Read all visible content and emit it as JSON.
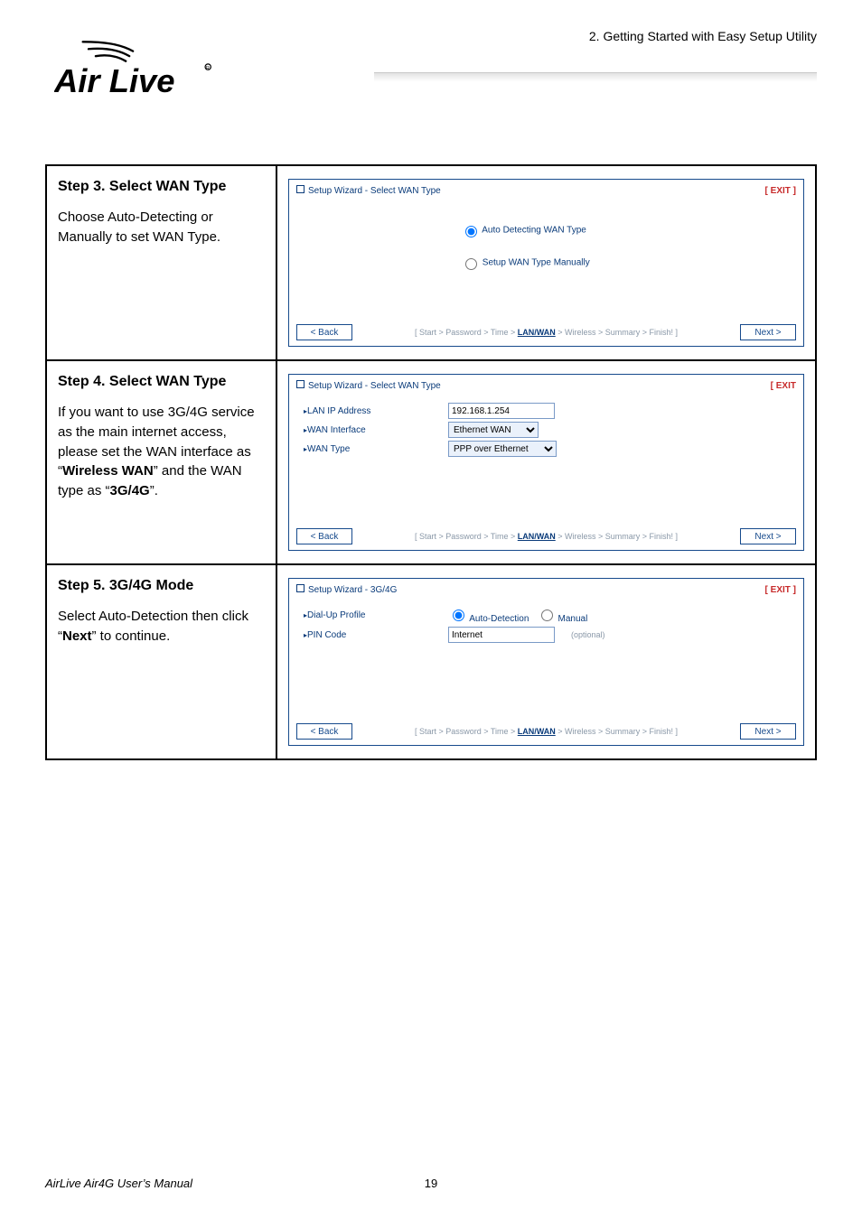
{
  "header": {
    "chapter": "2.  Getting  Started  with  Easy  Setup  Utility",
    "logo_alt": "Air Live"
  },
  "steps": {
    "s3": {
      "title": "Step 3.  Select WAN Type",
      "body": "Choose Auto-Detecting or Manually to set WAN Type."
    },
    "s4": {
      "title": "Step 4.  Select WAN Type",
      "body_1": "If you want to use 3G/4G service as the main internet access, please set the WAN interface as “",
      "body_bold1": "Wireless WAN",
      "body_2": "” and the WAN type as “",
      "body_bold2": "3G/4G",
      "body_3": "”."
    },
    "s5": {
      "title": "Step 5.  3G/4G Mode",
      "body_1": "Select Auto-Detection then click “",
      "body_bold": "Next",
      "body_2": "” to continue."
    }
  },
  "panel3": {
    "title": "Setup Wizard - Select WAN Type",
    "exit": "[ EXIT ]",
    "opt_auto": "Auto Detecting WAN Type",
    "opt_manual": "Setup WAN Type Manually",
    "back": "< Back",
    "next": "Next >",
    "crumb_prefix": "[ Start > Password > Time > ",
    "crumb_active": "LAN/WAN",
    "crumb_suffix": " > Wireless > Summary > Finish! ]"
  },
  "panel4": {
    "title": "Setup Wizard - Select WAN Type",
    "exit": "[ EXIT",
    "lan_label": "LAN IP Address",
    "lan_value": "192.168.1.254",
    "waninterface_label": "WAN Interface",
    "waninterface_value": "Ethernet WAN",
    "wantype_label": "WAN Type",
    "wantype_value": "PPP over Ethernet",
    "back": "< Back",
    "next": "Next >",
    "crumb_prefix": "[ Start > Password > Time > ",
    "crumb_active": "LAN/WAN",
    "crumb_suffix": " > Wireless > Summary > Finish! ]"
  },
  "panel5": {
    "title": "Setup Wizard - 3G/4G",
    "exit": "[ EXIT ]",
    "dialup_label": "Dial-Up Profile",
    "dialup_auto": "Auto-Detection",
    "dialup_manual": "Manual",
    "pin_label": "PIN Code",
    "pin_value": "Internet",
    "pin_optional": "(optional)",
    "back": "< Back",
    "next": "Next >",
    "crumb_prefix": "[ Start > Password > Time > ",
    "crumb_active": "LAN/WAN",
    "crumb_suffix": " > Wireless > Summary > Finish! ]"
  },
  "footer": {
    "manual": "AirLive Air4G User’s Manual",
    "page": "19"
  }
}
